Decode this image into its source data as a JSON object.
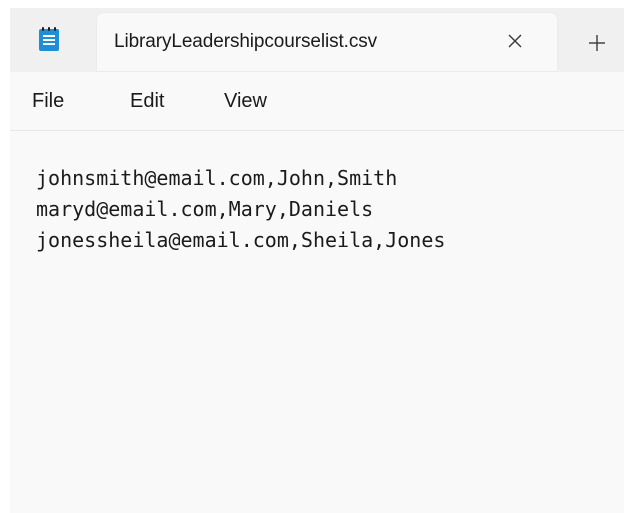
{
  "tab": {
    "title": "LibraryLeadershipcourselist.csv",
    "close_glyph": "×",
    "new_tab_glyph": "+"
  },
  "icons": {
    "app": "notepad-icon",
    "close": "close-icon",
    "new_tab": "plus-icon"
  },
  "menu": {
    "file": "File",
    "edit": "Edit",
    "view": "View"
  },
  "editor": {
    "lines": [
      "johnsmith@email.com,John,Smith",
      "maryd@email.com,Mary,Daniels",
      "jonessheila@email.com,Sheila,Jones"
    ]
  },
  "colors": {
    "icon_blue": "#1e8fd6",
    "text": "#1b1b1b"
  }
}
